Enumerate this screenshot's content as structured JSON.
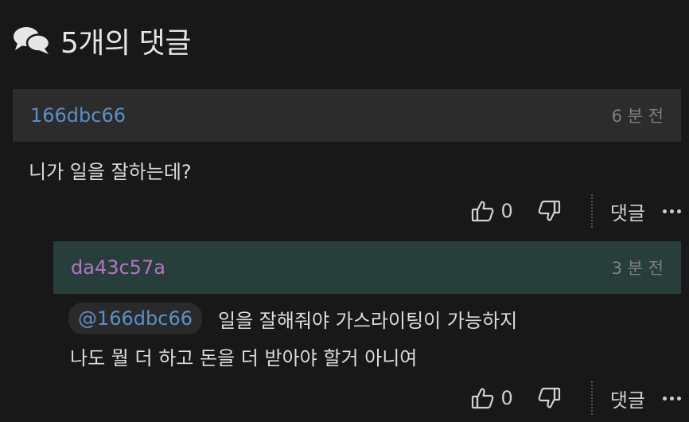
{
  "header": {
    "title": "5개의 댓글",
    "icon": "comments-icon"
  },
  "comments": [
    {
      "author": "166dbc66",
      "time": "6 분 전",
      "text": "니가 일을 잘하는데?",
      "likes": "0",
      "reply_label": "댓글"
    },
    {
      "author": "da43c57a",
      "time": "3 분 전",
      "mention": "@166dbc66",
      "text_line1": "일을 잘해줘야 가스라이팅이 가능하지",
      "text_line2": "나도 뭘 더 하고 돈을 더 받아야 할거 아니여",
      "likes": "0",
      "reply_label": "댓글"
    }
  ],
  "colors": {
    "background": "#181818",
    "author_blue": "#5b8fc6",
    "author_purple": "#b473c4",
    "reply_header_bg": "#283e3b",
    "comment_header_bg": "#2c2c2c"
  }
}
